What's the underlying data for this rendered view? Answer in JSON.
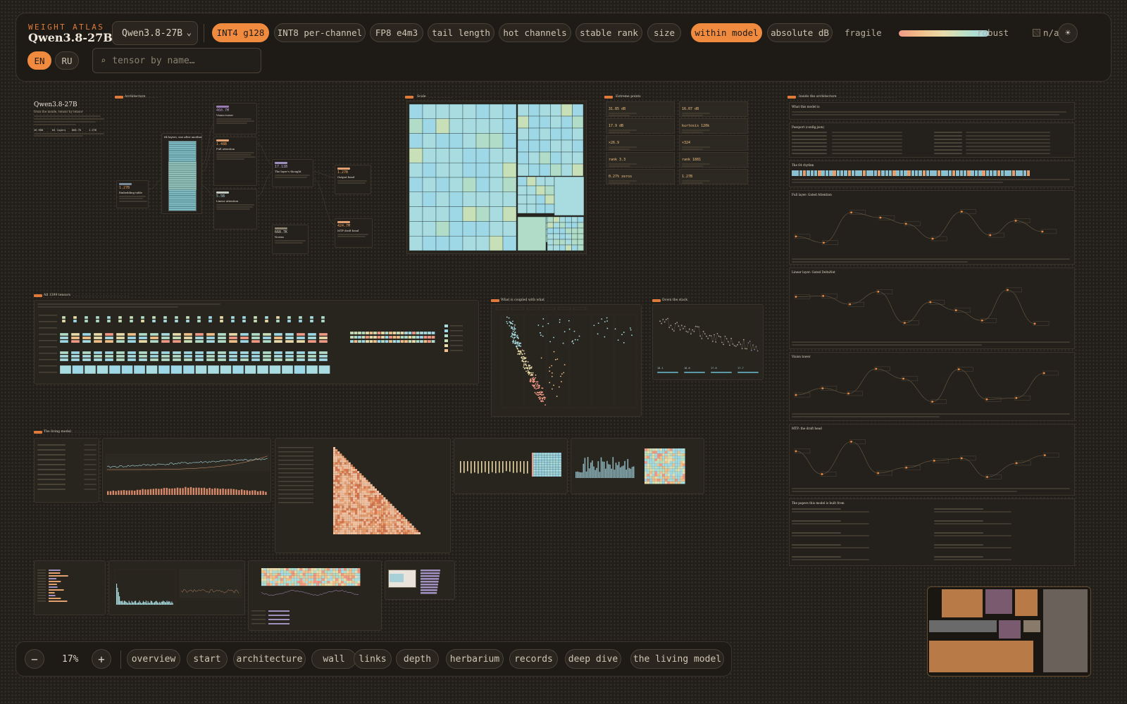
{
  "header": {
    "kicker": "WEIGHT ATLAS",
    "title": "Qwen3.8-27B",
    "model_select": "Qwen3.8-27B",
    "quant_modes": [
      "INT4 g128",
      "INT8 per-channel",
      "FP8 e4m3"
    ],
    "metrics": [
      "tail length",
      "hot channels",
      "stable rank",
      "size"
    ],
    "scales": [
      "within model",
      "absolute dB"
    ],
    "legend": {
      "low": "fragile",
      "high": "robust",
      "na": "n/a"
    },
    "languages": [
      "EN",
      "RU"
    ],
    "search_placeholder": "tensor by name…",
    "colors": {
      "accent": "#f08a3e",
      "background": "#221f1a",
      "panel": "#28241e"
    }
  },
  "canvas": {
    "hero": {
      "title": "Qwen3.8-27B",
      "subtitle": "from the inside, tensor by tensor"
    },
    "hero_stats": [
      "26.90B",
      "64 layers",
      "668.7K",
      "1.27B"
    ],
    "architecture": {
      "title": "Architecture",
      "stack_label": "64 layers, one after another",
      "cards": [
        {
          "value": "1.27B",
          "name": "Embedding table"
        },
        {
          "value": "460.7M",
          "name": "Vision tower"
        },
        {
          "value": "1.48B",
          "name": "Full attention"
        },
        {
          "value": "5.5B",
          "name": "Linear attention"
        },
        {
          "value": "17.11B",
          "name": "The layer's thought"
        },
        {
          "value": "668.7K",
          "name": "Norms"
        },
        {
          "value": "1.27B",
          "name": "Output head"
        },
        {
          "value": "424.7M",
          "name": "MTP draft head"
        }
      ]
    },
    "scale": {
      "title": "Scale"
    },
    "extremes": {
      "title": "Extreme points",
      "stats": [
        "31.85 dB",
        "16.07 dB",
        "17.9 dB",
        "kurtosis 120k",
        "×26.9",
        "×324",
        "rank 3.3",
        "rank 1881",
        "0.27% zeros",
        "1.27B"
      ]
    },
    "inside": {
      "title": "Inside the architecture",
      "sections": [
        "What this model is",
        "Passport (config.json)",
        "The 64 rhythm",
        "Full layer: Gated Attention",
        "Linear layer: Gated DeltaNet",
        "Vision tower",
        "MTP: the draft head",
        "The papers this model is built from"
      ]
    },
    "wall": {
      "title": "All 1399 tensors"
    },
    "coupled": {
      "title": "What is coupled with what"
    },
    "depth": {
      "title": "Down the stack",
      "stats": [
        "18.1",
        "18.6",
        "17.6",
        "17.7"
      ]
    },
    "living": {
      "title": "The living model"
    }
  },
  "footer": {
    "zoom_out": "−",
    "zoom": "17%",
    "zoom_in": "+",
    "nav": [
      "overview",
      "start",
      "architecture",
      "wall",
      "links",
      "depth",
      "herbarium",
      "records",
      "deep dive",
      "the living model"
    ]
  }
}
